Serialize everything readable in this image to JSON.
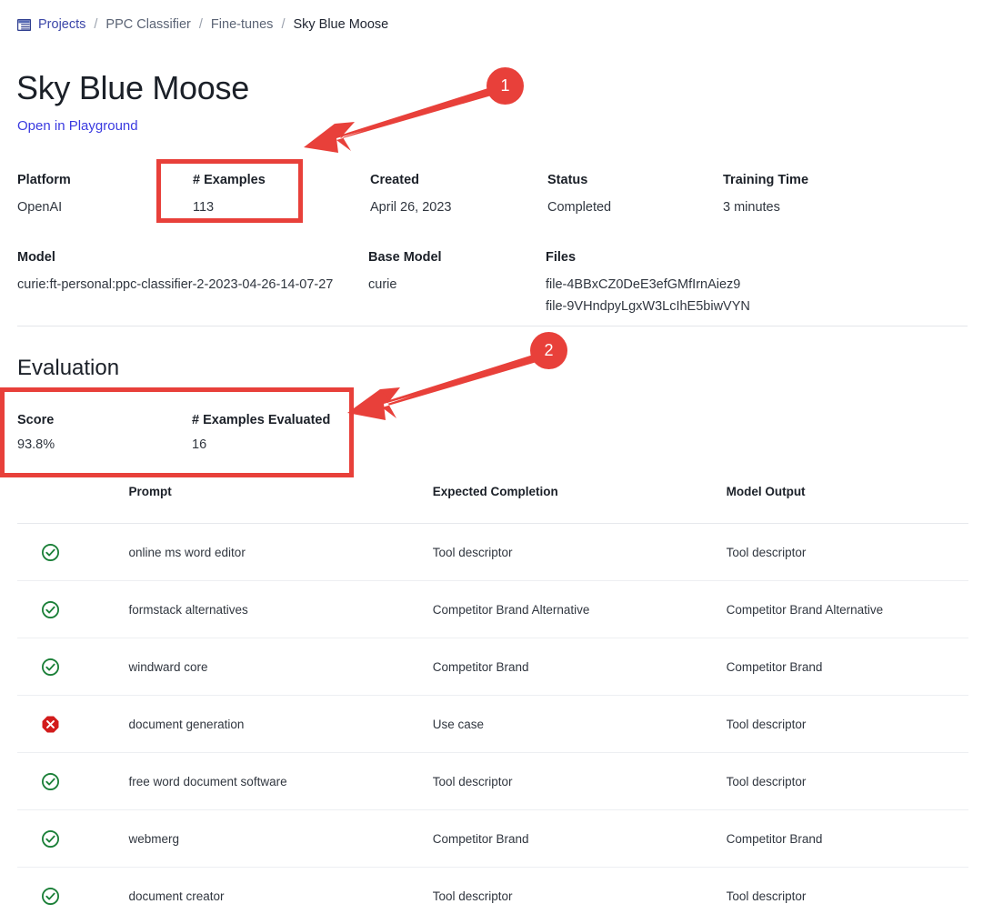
{
  "breadcrumb": {
    "icon": "window-icon",
    "separator": "/",
    "items": [
      {
        "label": "Projects",
        "kind": "link"
      },
      {
        "label": "PPC Classifier",
        "kind": "link-muted"
      },
      {
        "label": "Fine-tunes",
        "kind": "link-muted"
      },
      {
        "label": "Sky Blue Moose",
        "kind": "current"
      }
    ]
  },
  "header": {
    "title": "Sky Blue Moose",
    "playground_link": "Open in Playground"
  },
  "meta": {
    "platform_label": "Platform",
    "platform_value": "OpenAI",
    "examples_label": "# Examples",
    "examples_value": "113",
    "created_label": "Created",
    "created_value": "April 26, 2023",
    "status_label": "Status",
    "status_value": "Completed",
    "training_time_label": "Training Time",
    "training_time_value": "3 minutes",
    "model_label": "Model",
    "model_value": "curie:ft-personal:ppc-classifier-2-2023-04-26-14-07-27",
    "base_model_label": "Base Model",
    "base_model_value": "curie",
    "files_label": "Files",
    "files": [
      "file-4BBxCZ0DeE3efGMfIrnAiez9",
      "file-9VHndpyLgxW3LcIhE5biwVYN"
    ]
  },
  "evaluation": {
    "heading": "Evaluation",
    "score_label": "Score",
    "score_value": "93.8%",
    "examples_evaluated_label": "# Examples Evaluated",
    "examples_evaluated_value": "16",
    "columns": [
      "",
      "Prompt",
      "Expected Completion",
      "Model Output"
    ],
    "rows": [
      {
        "status": "pass",
        "status_icon": "check-circle-icon",
        "prompt": "online ms word editor",
        "expected": "Tool descriptor",
        "output": "Tool descriptor"
      },
      {
        "status": "pass",
        "status_icon": "check-circle-icon",
        "prompt": "formstack alternatives",
        "expected": "Competitor Brand Alternative",
        "output": "Competitor Brand Alternative"
      },
      {
        "status": "pass",
        "status_icon": "check-circle-icon",
        "prompt": "windward core",
        "expected": "Competitor Brand",
        "output": "Competitor Brand"
      },
      {
        "status": "fail",
        "status_icon": "x-circle-icon",
        "prompt": "document generation",
        "expected": "Use case",
        "output": "Tool descriptor"
      },
      {
        "status": "pass",
        "status_icon": "check-circle-icon",
        "prompt": "free word document software",
        "expected": "Tool descriptor",
        "output": "Tool descriptor"
      },
      {
        "status": "pass",
        "status_icon": "check-circle-icon",
        "prompt": "webmerg",
        "expected": "Competitor Brand",
        "output": "Competitor Brand"
      },
      {
        "status": "pass",
        "status_icon": "check-circle-icon",
        "prompt": "document creator",
        "expected": "Tool descriptor",
        "output": "Tool descriptor"
      }
    ]
  },
  "annotations": {
    "color": "#e8403a",
    "markers": [
      {
        "number": "1",
        "target": "# Examples"
      },
      {
        "number": "2",
        "target": "Evaluation summary"
      }
    ]
  },
  "colors": {
    "link": "#3a3ae0",
    "breadcrumb_link": "#3b46a8",
    "annotation_red": "#e8403a",
    "pass_green": "#1a7f37",
    "fail_red": "#d21c1c",
    "text": "#1b2028"
  }
}
